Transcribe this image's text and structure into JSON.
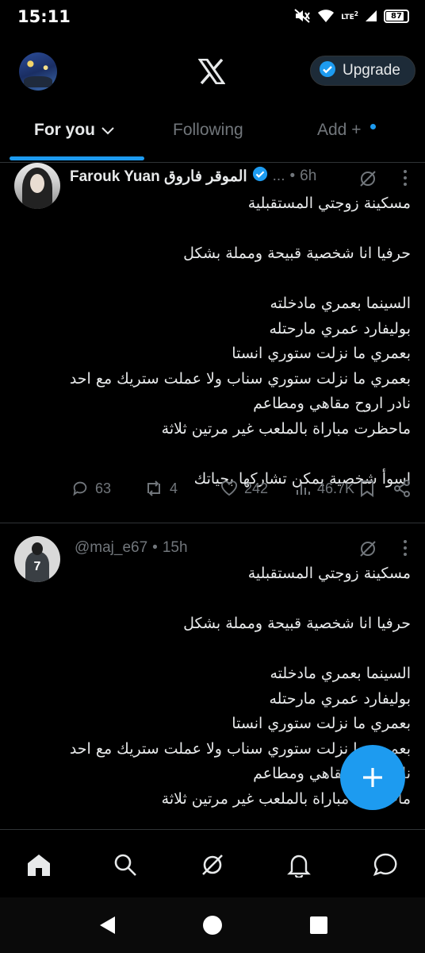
{
  "status_bar": {
    "time": "15:11",
    "network": "LTE",
    "sim_slot": "2",
    "battery": "87",
    "battery_level": 0.87
  },
  "header": {
    "logo": "x-logo",
    "upgrade_label": "Upgrade"
  },
  "tabs": [
    {
      "label": "For you",
      "active": true
    },
    {
      "label": "Following",
      "active": false
    },
    {
      "label": "Add +",
      "active": false
    }
  ],
  "tweets": [
    {
      "name": "Farouk Yuan الموقر فاروق",
      "handle_truncated": "...",
      "dot": "•",
      "time": "6h",
      "verified": true,
      "text": "مسكينة زوجتي المستقبلية\n\nحرفيا انا شخصية قبيحة ومملة بشكل\n\nالسينما بعمري مادخلته\nبوليفارد عمري مارحتله\nبعمري ما نزلت ستوري انستا\nبعمري ما نزلت ستوري سناب ولا عملت ستريك مع احد\nنادر اروح مقاهي ومطاعم\nماحظرت مباراة بالملعب غير مرتين ثلاثة\n\nاسوأ شخصية يمكن تشاركها بحياتك",
      "replies": "63",
      "reposts": "4",
      "likes": "242",
      "views": "46.7K"
    },
    {
      "handle": "@maj_e67",
      "dot": "•",
      "time": "15h",
      "avatar_number": "7",
      "text": "مسكينة زوجتي المستقبلية\n\nحرفيا انا شخصية قبيحة ومملة بشكل\n\nالسينما بعمري مادخلته\nبوليفارد عمري مارحتله\nبعمري ما نزلت ستوري انستا\nبعمري ما نزلت ستوري سناب ولا عملت ستريك مع احد\nنادر اروح مقاهي ومطاعم\nماحظرت مباراة بالملعب غير مرتين ثلاثة\n\nاسوأ شخصية يمكن تشاركها بحياتك"
    }
  ],
  "bottom_nav": [
    "home-icon",
    "search-icon",
    "grok-icon",
    "notifications-icon",
    "messages-icon"
  ],
  "colors": {
    "accent": "#1d9bf0",
    "background": "#000000",
    "secondary_text": "#71767b",
    "divider": "#2f3336"
  }
}
